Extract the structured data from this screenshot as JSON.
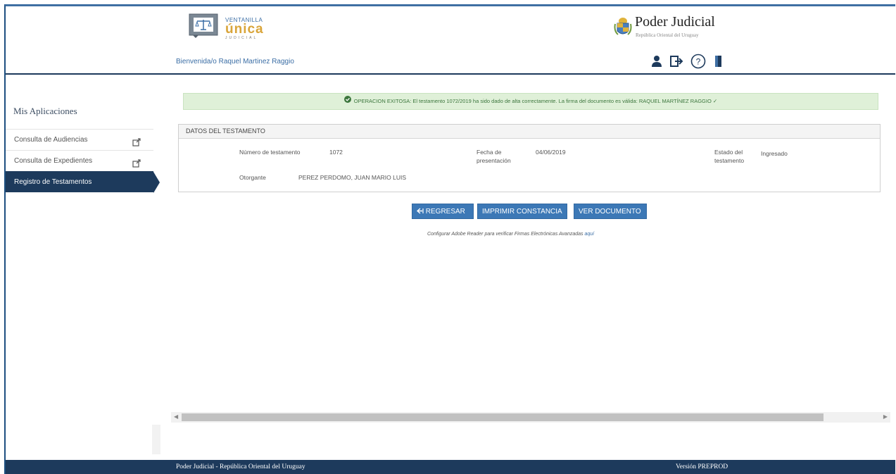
{
  "header": {
    "logo": {
      "line1": "VENTANILLA",
      "line2": "única",
      "line3": "JUDICIAL"
    },
    "welcome": "Bienvenida/o Raquel Martinez Raggio",
    "brand_title": "Poder Judicial",
    "brand_subtitle": "República Oriental del Uruguay",
    "icons": [
      "user-icon",
      "logout-box-icon",
      "help-icon",
      "exit-door-icon"
    ]
  },
  "sidebar": {
    "title": "Mis Aplicaciones",
    "items": [
      {
        "label": "Consulta de Audiencias",
        "icon": "external-link-icon"
      },
      {
        "label": "Consulta de Expedientes",
        "icon": "external-link-icon"
      },
      {
        "label": "Registro de Testamentos",
        "active": true
      }
    ]
  },
  "alert": {
    "text": "OPERACION EXITOSA: El testamento 1072/2019 ha sido dado de alta correctamente. La firma del documento es válida: RAQUEL MARTÍNEZ RAGGIO ✓"
  },
  "panel": {
    "title": "DATOS DEL TESTAMENTO",
    "numero_label": "Número de testamento",
    "numero_value": "1072",
    "fecha_label_1": "Fecha de",
    "fecha_label_2": "presentación",
    "fecha_value": "04/06/2019",
    "estado_label_1": "Estado del",
    "estado_label_2": "testamento",
    "estado_value": "Ingresado",
    "otorgante_label": "Otorgante",
    "otorgante_value": "PEREZ PERDOMO, JUAN MARIO LUIS"
  },
  "buttons": {
    "regresar": "REGRESAR",
    "imprimir": "IMPRIMIR CONSTANCIA",
    "ver": "VER DOCUMENTO"
  },
  "note": {
    "text": "Configurar Adobe Reader para verificar Firmas Electrónicas Avanzadas",
    "link": "aquí"
  },
  "footer": {
    "left": "Poder Judicial - República Oriental del Uruguay",
    "right": "Versión PREPROD"
  },
  "colors": {
    "navy": "#1d3a5c",
    "button_blue": "#3c78b6",
    "success_bg": "#dff0d8",
    "logo_gold": "#d9a53a"
  }
}
